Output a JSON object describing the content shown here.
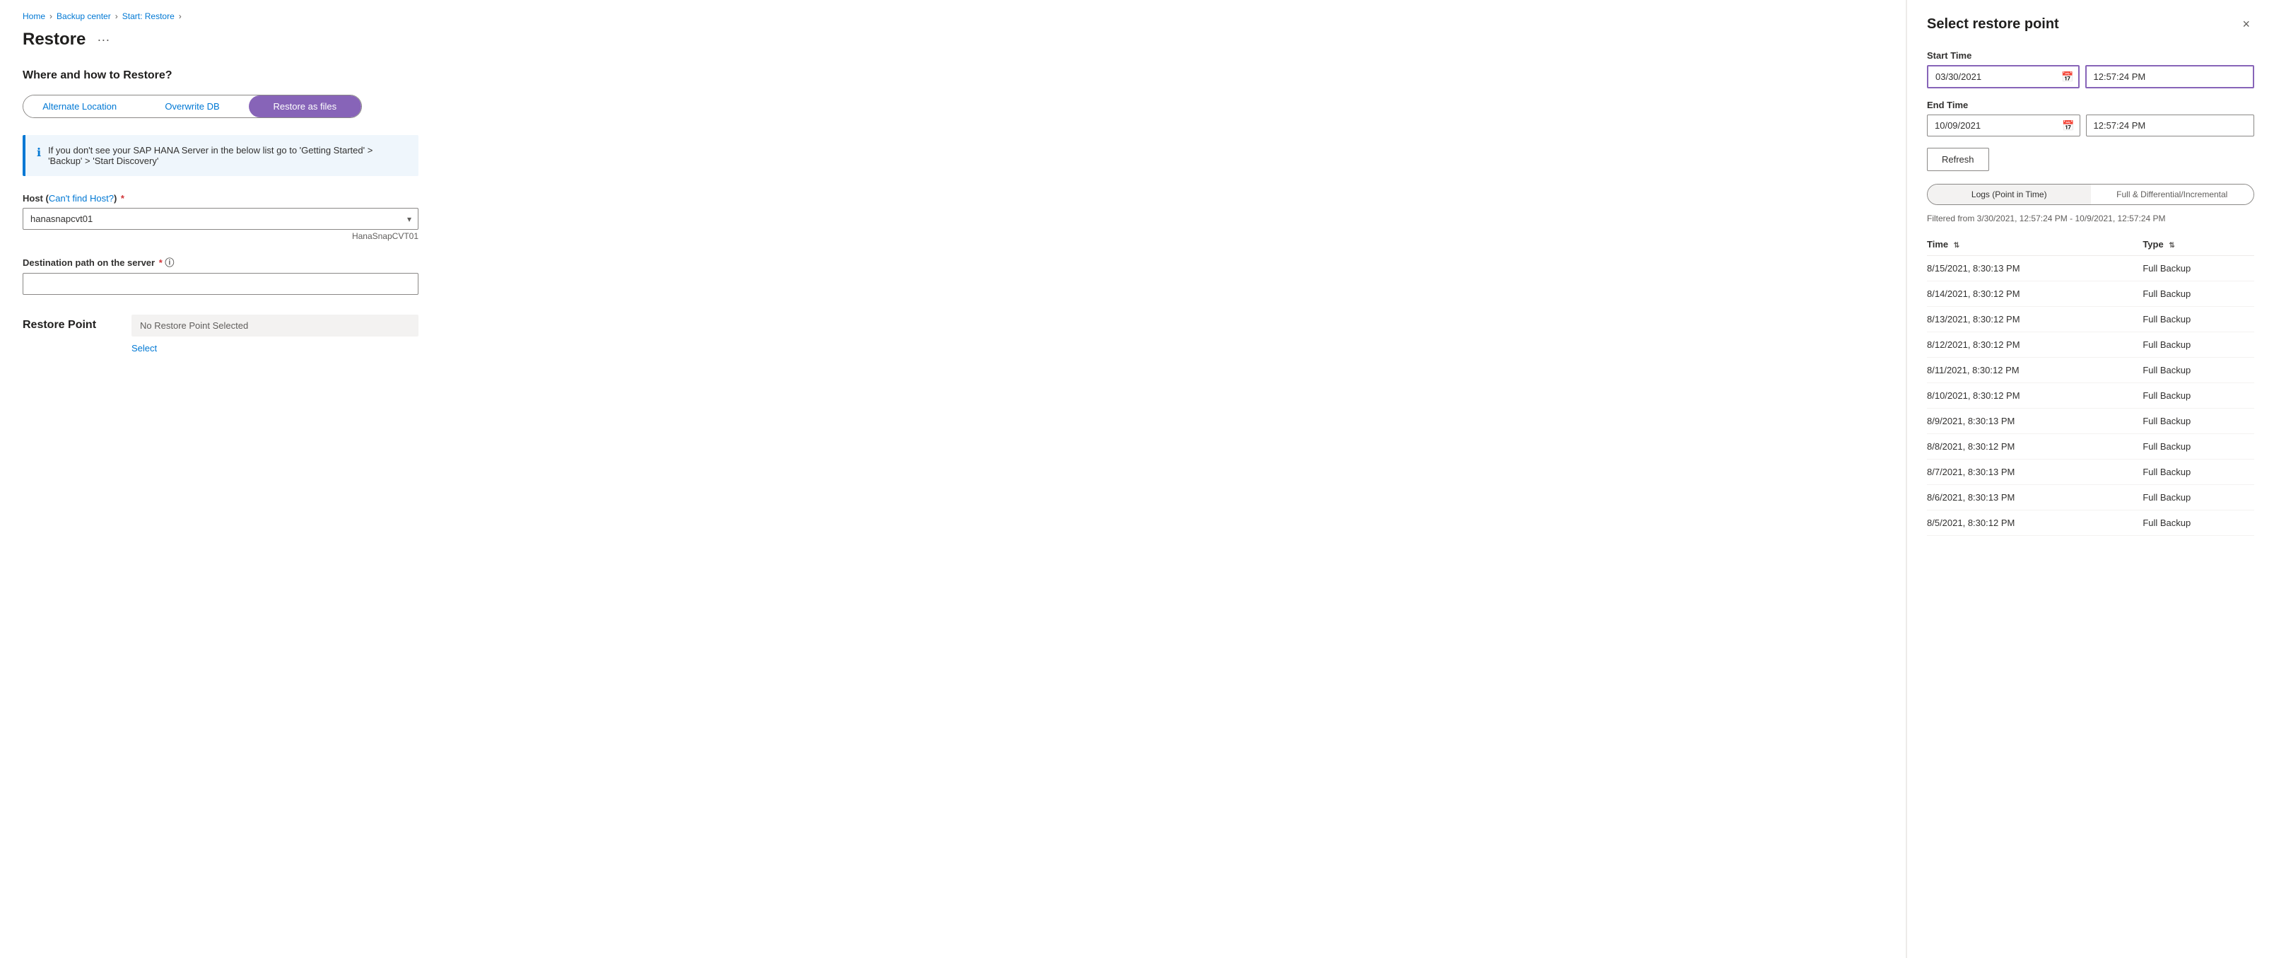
{
  "breadcrumb": {
    "items": [
      "Home",
      "Backup center",
      "Start: Restore"
    ]
  },
  "page": {
    "title": "Restore",
    "ellipsis": "···"
  },
  "left": {
    "section_heading": "Where and how to Restore?",
    "tabs": [
      {
        "id": "alternate",
        "label": "Alternate Location",
        "active": false
      },
      {
        "id": "overwrite",
        "label": "Overwrite DB",
        "active": false
      },
      {
        "id": "files",
        "label": "Restore as files",
        "active": true
      }
    ],
    "info_message": "If you don't see your SAP HANA Server in the below list go to 'Getting Started' > 'Backup' > 'Start Discovery'",
    "host_label": "Host",
    "host_link": "Can't find Host?",
    "host_required": true,
    "host_value": "hanasnapcvt01",
    "host_hint": "HanaSnapCVT01",
    "dest_path_label": "Destination path on the server",
    "dest_path_required": true,
    "dest_path_value": "",
    "dest_path_placeholder": "",
    "restore_point_label": "Restore Point",
    "restore_point_value": "No Restore Point Selected",
    "select_label": "Select"
  },
  "right": {
    "title": "Select restore point",
    "close_label": "×",
    "start_time_label": "Start Time",
    "start_date_value": "03/30/2021",
    "start_time_value": "12:57:24 PM",
    "end_time_label": "End Time",
    "end_date_value": "10/09/2021",
    "end_time_value": "12:57:24 PM",
    "refresh_label": "Refresh",
    "view_tabs": [
      {
        "id": "logs",
        "label": "Logs (Point in Time)",
        "active": false
      },
      {
        "id": "full",
        "label": "Full & Differential/Incremental",
        "active": false
      }
    ],
    "filter_text": "Filtered from 3/30/2021, 12:57:24 PM - 10/9/2021, 12:57:24 PM",
    "table": {
      "col_time": "Time",
      "col_type": "Type",
      "rows": [
        {
          "time": "8/15/2021, 8:30:13 PM",
          "type": "Full Backup"
        },
        {
          "time": "8/14/2021, 8:30:12 PM",
          "type": "Full Backup"
        },
        {
          "time": "8/13/2021, 8:30:12 PM",
          "type": "Full Backup"
        },
        {
          "time": "8/12/2021, 8:30:12 PM",
          "type": "Full Backup"
        },
        {
          "time": "8/11/2021, 8:30:12 PM",
          "type": "Full Backup"
        },
        {
          "time": "8/10/2021, 8:30:12 PM",
          "type": "Full Backup"
        },
        {
          "time": "8/9/2021, 8:30:13 PM",
          "type": "Full Backup"
        },
        {
          "time": "8/8/2021, 8:30:12 PM",
          "type": "Full Backup"
        },
        {
          "time": "8/7/2021, 8:30:13 PM",
          "type": "Full Backup"
        },
        {
          "time": "8/6/2021, 8:30:13 PM",
          "type": "Full Backup"
        },
        {
          "time": "8/5/2021, 8:30:12 PM",
          "type": "Full Backup"
        }
      ]
    }
  }
}
